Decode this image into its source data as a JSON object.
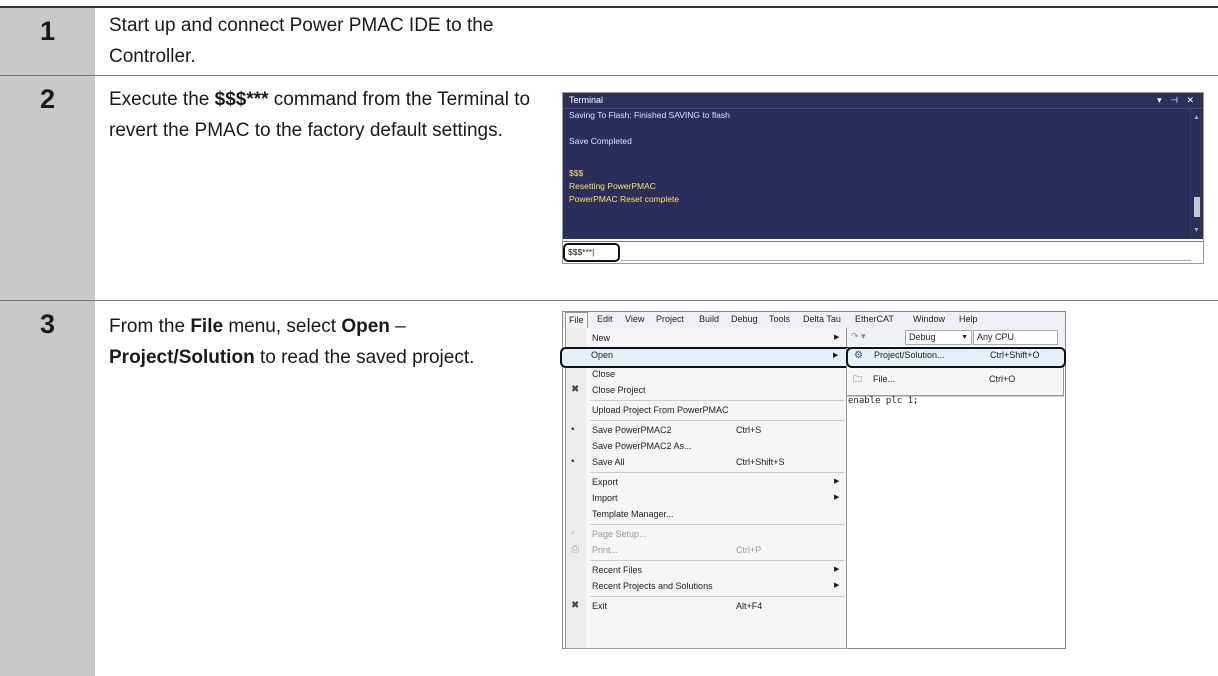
{
  "steps": [
    {
      "number": "1",
      "text": "Start up and connect Power PMAC IDE to the Controller."
    },
    {
      "number": "2",
      "text_pre": "Execute the ",
      "text_bold": "$$$***",
      "text_post": " command from the Terminal to revert the PMAC to the factory default settings."
    },
    {
      "number": "3",
      "p1": "From the ",
      "b1": "File",
      "p2": " menu, select ",
      "b2": "Open",
      "p3": " – ",
      "b3": "Project/Solution",
      "p4": " to read the saved project."
    }
  ],
  "terminal": {
    "title": "Terminal",
    "controls": "▾ ⊣ ✕",
    "lines": [
      "Saving To Flash: Finished SAVING to flash",
      "Save Completed",
      "$$$",
      "Resetting PowerPMAC",
      "PowerPMAC Reset complete"
    ],
    "input_value": "$$$***|"
  },
  "ide": {
    "menubar": [
      "File",
      "Edit",
      "View",
      "Project",
      "Build",
      "Debug",
      "Tools",
      "Delta Tau",
      "EtherCAT",
      "Window",
      "Help"
    ],
    "config_dropdown": "Debug",
    "platform_dropdown": "Any CPU",
    "code_line": "enable plc 1;",
    "file_menu": {
      "new": "New",
      "open": "Open",
      "close": "Close",
      "close_project": "Close Project",
      "upload_project": "Upload Project From PowerPMAC",
      "save": "Save PowerPMAC2",
      "save_shortcut": "Ctrl+S",
      "save_as": "Save PowerPMAC2 As...",
      "save_all": "Save All",
      "save_all_shortcut": "Ctrl+Shift+S",
      "export": "Export",
      "import": "Import",
      "template_manager": "Template Manager...",
      "page_setup": "Page Setup...",
      "print": "Print...",
      "print_shortcut": "Ctrl+P",
      "recent_files": "Recent Files",
      "recent_projects": "Recent Projects and Solutions",
      "exit": "Exit",
      "exit_shortcut": "Alt+F4"
    },
    "open_submenu": {
      "project_solution": "Project/Solution...",
      "project_solution_shortcut": "Ctrl+Shift+O",
      "file": "File...",
      "file_shortcut": "Ctrl+O"
    }
  }
}
